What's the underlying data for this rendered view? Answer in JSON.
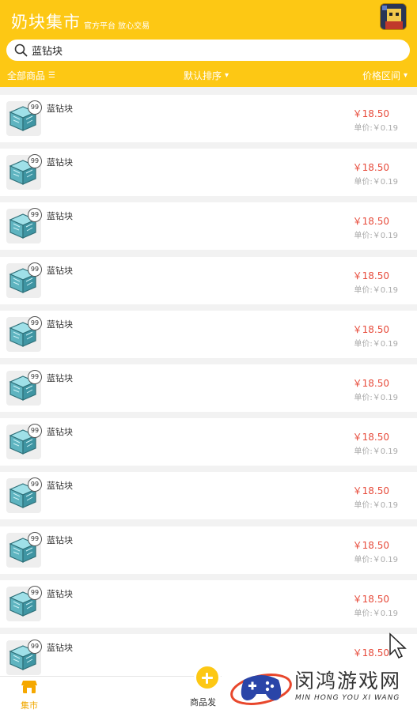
{
  "header": {
    "brand": "奶块集市",
    "slogan": "官方平台 放心交易",
    "avatar_icon": "game-avatar-icon"
  },
  "search": {
    "value": "蓝钻块",
    "placeholder": "蓝钻块",
    "icon": "search-icon"
  },
  "filters": {
    "all_goods": "全部商品",
    "all_goods_glyph": "☰",
    "sort": "默认排序",
    "sort_glyph": "▾",
    "price_range": "价格区间",
    "price_range_glyph": "▾"
  },
  "items": [
    {
      "name": "蓝钻块",
      "qty": "99",
      "price": "￥18.50",
      "unit_price": "单价:￥0.19"
    },
    {
      "name": "蓝钻块",
      "qty": "99",
      "price": "￥18.50",
      "unit_price": "单价:￥0.19"
    },
    {
      "name": "蓝钻块",
      "qty": "99",
      "price": "￥18.50",
      "unit_price": "单价:￥0.19"
    },
    {
      "name": "蓝钻块",
      "qty": "99",
      "price": "￥18.50",
      "unit_price": "单价:￥0.19"
    },
    {
      "name": "蓝钻块",
      "qty": "99",
      "price": "￥18.50",
      "unit_price": "单价:￥0.19"
    },
    {
      "name": "蓝钻块",
      "qty": "99",
      "price": "￥18.50",
      "unit_price": "单价:￥0.19"
    },
    {
      "name": "蓝钻块",
      "qty": "99",
      "price": "￥18.50",
      "unit_price": "单价:￥0.19"
    },
    {
      "name": "蓝钻块",
      "qty": "99",
      "price": "￥18.50",
      "unit_price": "单价:￥0.19"
    },
    {
      "name": "蓝钻块",
      "qty": "99",
      "price": "￥18.50",
      "unit_price": "单价:￥0.19"
    },
    {
      "name": "蓝钻块",
      "qty": "99",
      "price": "￥18.50",
      "unit_price": "单价:￥0.19"
    },
    {
      "name": "蓝钻块",
      "qty": "99",
      "price": "￥18.50",
      "unit_price": ""
    }
  ],
  "tabbar": {
    "market": "集市",
    "publish": "商品发"
  },
  "watermark": {
    "cn": "闵鸿游戏网",
    "en": "MIN HONG YOU XI WANG"
  },
  "colors": {
    "accent": "#fdc814",
    "price": "#e74c3c",
    "diamond_block": "#6cc3cf"
  }
}
